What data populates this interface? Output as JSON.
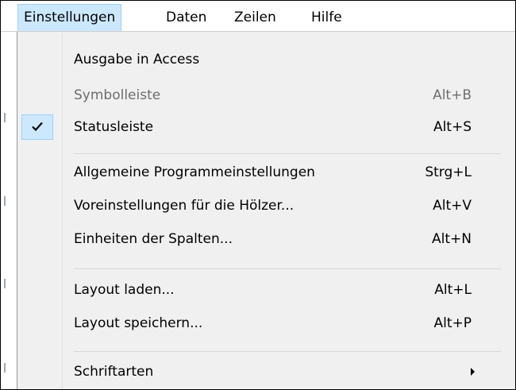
{
  "menubar": {
    "items": [
      {
        "label": "Einstellungen",
        "active": true
      },
      {
        "label": "Daten"
      },
      {
        "label": "Zeilen"
      },
      {
        "label": "Hilfe"
      }
    ]
  },
  "dropdown": {
    "items": [
      {
        "label": "Ausgabe in Access",
        "shortcut": ""
      },
      {
        "label": "Symbolleiste",
        "shortcut": "Alt+B",
        "disabled": true
      },
      {
        "label": "Statusleiste",
        "shortcut": "Alt+S",
        "checked": true
      },
      {
        "label": "Allgemeine Programmeinstellungen",
        "shortcut": "Strg+L"
      },
      {
        "label": "Voreinstellungen für die Hölzer...",
        "shortcut": "Alt+V"
      },
      {
        "label": "Einheiten der Spalten...",
        "shortcut": "Alt+N"
      },
      {
        "label": "Layout laden...",
        "shortcut": "Alt+L"
      },
      {
        "label": "Layout speichern...",
        "shortcut": "Alt+P"
      },
      {
        "label": "Schriftarten",
        "shortcut": "",
        "submenu": true
      }
    ]
  },
  "colors": {
    "highlight": "#cce8ff",
    "highlight_border": "#99d1ff",
    "menu_background": "#f0f0f0",
    "disabled_text": "#6d6d6d"
  },
  "icons": {
    "checkmark": "check-icon",
    "submenu": "chevron-right-icon"
  }
}
